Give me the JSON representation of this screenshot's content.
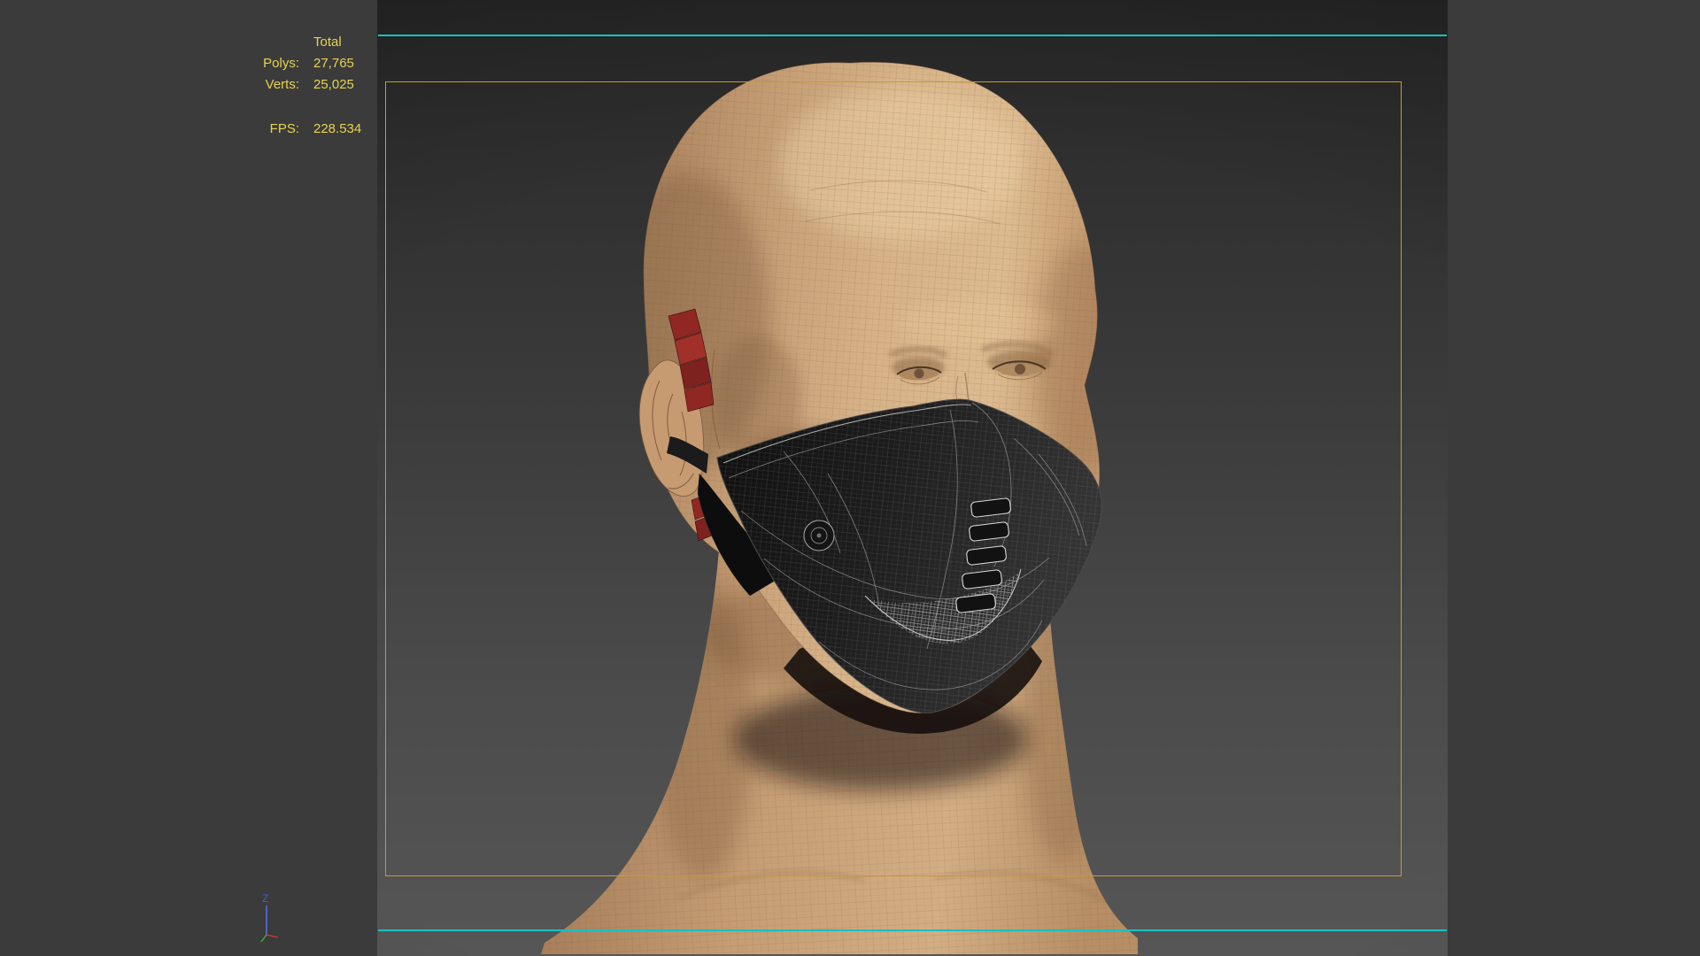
{
  "viewport": {
    "statistics": {
      "total_label": "Total",
      "polys_label": "Polys:",
      "polys_value": "27,765",
      "verts_label": "Verts:",
      "verts_value": "25,025",
      "fps_label": "FPS:",
      "fps_value": "228.534"
    },
    "axis_gizmo": {
      "z_axis_label": "Z"
    },
    "colors": {
      "stats_text": "#e6d351",
      "title_safe_frame": "#c79b2e",
      "action_safe_frame": "#16c2c2",
      "background_outer": "#3b3b3b",
      "render_area_top": "#262626",
      "render_area_bottom": "#565656",
      "model_skin": "#d7b288",
      "model_mask": "#1c1c1c",
      "wire_accent_red": "#8f2723"
    },
    "model_description": "wireframe head with respirator mask"
  }
}
